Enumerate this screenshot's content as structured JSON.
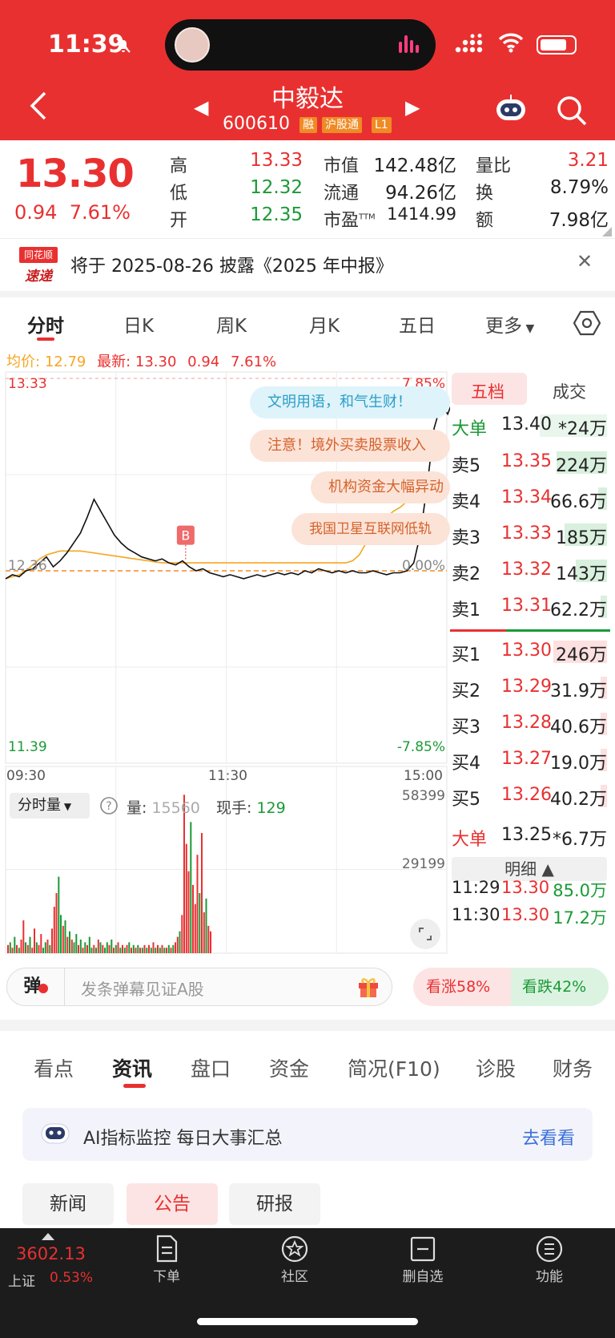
{
  "status": {
    "time": "11:39"
  },
  "header": {
    "stock_name": "中毅达",
    "stock_code": "600610",
    "tags": [
      "融",
      "沪股通",
      "L1"
    ]
  },
  "quote": {
    "price": "13.30",
    "change": "0.94",
    "change_pct": "7.61%",
    "stats": [
      {
        "label": "高",
        "value": "13.33",
        "color": "red"
      },
      {
        "label": "低",
        "value": "12.32",
        "color": "green"
      },
      {
        "label": "开",
        "value": "12.35",
        "color": "green"
      },
      {
        "label": "市值",
        "value": "142.48亿",
        "color": "dark"
      },
      {
        "label": "流通",
        "value": "94.26亿",
        "color": "dark"
      },
      {
        "label": "市盈",
        "value": "1414.99",
        "color": "dark",
        "sup": "TTM"
      },
      {
        "label": "量比",
        "value": "3.21",
        "color": "red"
      },
      {
        "label": "换",
        "value": "8.79%",
        "color": "dark"
      },
      {
        "label": "额",
        "value": "7.98亿",
        "color": "dark"
      }
    ]
  },
  "newsbar": {
    "logo_top": "同花顺",
    "logo_bottom": "速递",
    "text": "将于 2025-08-26 披露《2025 年中报》"
  },
  "chart_tabs": [
    "分时",
    "日K",
    "周K",
    "月K",
    "五日",
    "更多"
  ],
  "avg_line": {
    "avg_label": "均价:",
    "avg_value": "12.79",
    "latest_label": "最新:",
    "latest_value": "13.30",
    "change": "0.94",
    "pct": "7.61%"
  },
  "chart_data": {
    "type": "line",
    "x_labels": [
      "09:30",
      "11:30",
      "15:00"
    ],
    "y_left": {
      "top": "13.33",
      "mid": "12.36",
      "bottom": "11.39"
    },
    "y_right": {
      "top": "7.85%",
      "mid": "0.00%",
      "bottom": "-7.85%"
    },
    "ylim": [
      11.39,
      13.33
    ],
    "base": 12.36,
    "series": [
      {
        "values": [
          12.32,
          12.34,
          12.33,
          12.36,
          12.37,
          12.4,
          12.43,
          12.38,
          12.41,
          12.45,
          12.5,
          12.55,
          12.63,
          12.72,
          12.66,
          12.6,
          12.54,
          12.5,
          12.47,
          12.45,
          12.43,
          12.42,
          12.41,
          12.42,
          12.4,
          12.39,
          12.41,
          12.38,
          12.36,
          12.37,
          12.35,
          12.34,
          12.33,
          12.34,
          12.33,
          12.32,
          12.33,
          12.34,
          12.33,
          12.34,
          12.35,
          12.34,
          12.35,
          12.34,
          12.36,
          12.35,
          12.37,
          12.36,
          12.35,
          12.36,
          12.35,
          12.36,
          12.35,
          12.35,
          12.36,
          12.35,
          12.34,
          12.35,
          12.35,
          12.36,
          12.4,
          12.55,
          12.8,
          13.08,
          13.2,
          13.15,
          13.24,
          13.18,
          13.28,
          13.25,
          13.3,
          13.27,
          13.33,
          13.3
        ]
      },
      {
        "values": [
          12.32,
          12.33,
          12.34,
          12.36,
          12.39,
          12.42,
          12.44,
          12.45,
          12.46,
          12.46,
          12.46,
          12.46,
          12.455,
          12.45,
          12.445,
          12.44,
          12.435,
          12.43,
          12.425,
          12.42,
          12.415,
          12.41,
          12.405,
          12.4,
          12.4,
          12.4,
          12.4,
          12.4,
          12.4,
          12.4,
          12.4,
          12.4,
          12.4,
          12.4,
          12.4,
          12.4,
          12.4,
          12.4,
          12.4,
          12.4,
          12.4,
          12.4,
          12.4,
          12.4,
          12.4,
          12.4,
          12.4,
          12.4,
          12.4,
          12.4,
          12.4,
          12.41,
          12.44,
          12.5,
          12.56,
          12.6,
          12.63,
          12.66,
          12.68,
          12.71,
          12.73,
          12.76,
          12.79
        ]
      }
    ],
    "buy_marker": "B",
    "volume": {
      "label": "分时量",
      "vol_label": "量:",
      "vol_value": "15560",
      "now_label": "现手:",
      "now_value": "129",
      "y_top": "58399",
      "y_mid": "29199",
      "ymax": 58399,
      "bars": [
        3,
        4,
        2,
        6,
        3,
        2,
        5,
        12,
        4,
        3,
        6,
        2,
        9,
        4,
        3,
        7,
        2,
        4,
        5,
        3,
        9,
        17,
        22,
        28,
        14,
        10,
        12,
        6,
        8,
        5,
        4,
        7,
        3,
        5,
        2,
        4,
        3,
        6,
        2,
        3,
        2,
        5,
        4,
        3,
        2,
        4,
        3,
        5,
        2,
        3,
        4,
        2,
        3,
        2,
        3,
        4,
        2,
        3,
        2,
        3,
        2,
        2,
        3,
        2,
        3,
        2,
        4,
        2,
        3,
        2,
        3,
        2,
        2,
        3,
        2,
        3,
        4,
        6,
        8,
        14,
        58,
        40,
        30,
        48,
        25,
        18,
        36,
        22,
        44,
        15,
        20,
        10,
        8
      ],
      "colors": [
        "r",
        "g",
        "r",
        "g",
        "r",
        "g",
        "r",
        "r",
        "g",
        "r",
        "g",
        "r",
        "r",
        "g",
        "r",
        "r",
        "g",
        "g",
        "r",
        "g",
        "r",
        "r",
        "r",
        "g",
        "g",
        "r",
        "g",
        "r",
        "g",
        "r",
        "g",
        "g",
        "r",
        "g",
        "r",
        "g",
        "r",
        "g",
        "g",
        "r",
        "g",
        "r",
        "g",
        "r",
        "g",
        "g",
        "r",
        "g",
        "r",
        "g",
        "r",
        "g",
        "r",
        "g",
        "r",
        "g",
        "r",
        "g",
        "r",
        "g",
        "r",
        "g",
        "r",
        "g",
        "r",
        "g",
        "r",
        "g",
        "r",
        "g",
        "r",
        "g",
        "r",
        "g",
        "r",
        "g",
        "r",
        "r",
        "g",
        "r",
        "r",
        "r",
        "r",
        "g",
        "r",
        "r",
        "r",
        "g",
        "r",
        "r",
        "g",
        "r",
        "r"
      ]
    }
  },
  "bubbles": [
    "文明用语，和气生财！",
    "注意！境外买卖股票收入",
    "机构资金大幅异动",
    "我国卫星互联网低轨"
  ],
  "orderbook": {
    "tabs": [
      "五档",
      "成交"
    ],
    "big_sell": {
      "label": "大单",
      "price": "13.40",
      "vol": "*24万"
    },
    "asks": [
      {
        "label": "卖5",
        "price": "13.35",
        "vol": "224万",
        "bar": 0.9
      },
      {
        "label": "卖4",
        "price": "13.34",
        "vol": "66.6万",
        "bar": 0.15
      },
      {
        "label": "卖3",
        "price": "13.33",
        "vol": "185万",
        "bar": 0.75
      },
      {
        "label": "卖2",
        "price": "13.32",
        "vol": "143万",
        "bar": 0.55
      },
      {
        "label": "卖1",
        "price": "13.31",
        "vol": "62.2万",
        "bar": 0.12
      }
    ],
    "bids": [
      {
        "label": "买1",
        "price": "13.30",
        "vol": "246万",
        "bar": 0.95
      },
      {
        "label": "买2",
        "price": "13.29",
        "vol": "31.9万",
        "bar": 0.05
      },
      {
        "label": "买3",
        "price": "13.28",
        "vol": "40.6万",
        "bar": 0.08
      },
      {
        "label": "买4",
        "price": "13.27",
        "vol": "19.0万",
        "bar": 0.04
      },
      {
        "label": "买5",
        "price": "13.26",
        "vol": "40.2万",
        "bar": 0.08
      }
    ],
    "big_buy": {
      "label": "大单",
      "price": "13.25",
      "vol": "*6.7万"
    },
    "detail_label": "明细",
    "trades": [
      {
        "time": "11:29",
        "price": "13.30",
        "vol": "85.0万"
      },
      {
        "time": "11:30",
        "price": "13.30",
        "vol": "17.2万"
      }
    ]
  },
  "danmu": {
    "button": "弹",
    "placeholder": "发条弹幕见证A股"
  },
  "sentiment": {
    "up": "看涨58%",
    "down": "看跌42%"
  },
  "info_tabs": [
    "看点",
    "资讯",
    "盘口",
    "资金",
    "简况(F10)",
    "诊股",
    "财务"
  ],
  "ai_bar": {
    "text": "AI指标监控  每日大事汇总",
    "link": "去看看"
  },
  "subtabs": [
    "新闻",
    "公告",
    "研报"
  ],
  "bottom_nav": {
    "index_value": "3602.13",
    "index_name": "上证",
    "index_pct": "0.53%",
    "items": [
      "下单",
      "社区",
      "删自选",
      "功能"
    ]
  },
  "colors": {
    "brand_red": "#e93030",
    "green": "#1a9a36",
    "orange_avg": "#f5a623"
  }
}
